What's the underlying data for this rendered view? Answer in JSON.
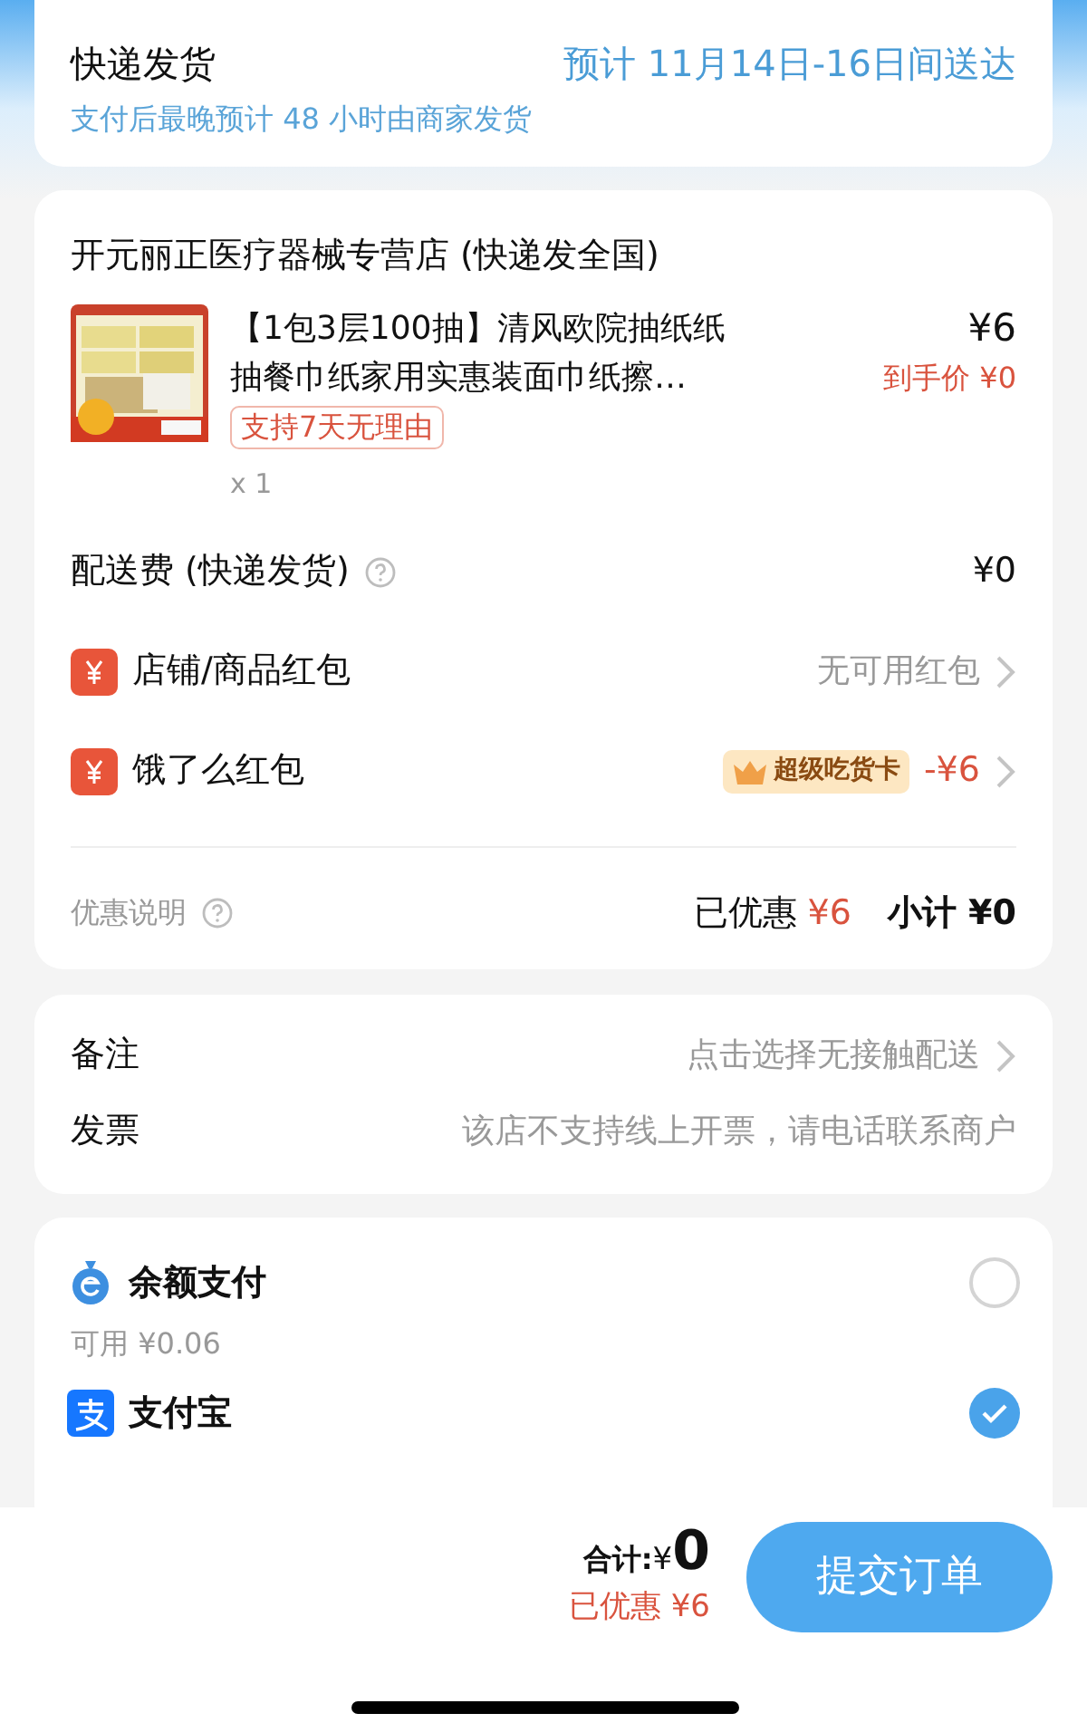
{
  "delivery": {
    "title": "快递发货",
    "eta": "预计 11月14日-16日间送达",
    "note": "支付后最晚预计 48 小时由商家发货"
  },
  "store": {
    "name": "开元丽正医疗器械专营店 (快递发全国)",
    "product": {
      "title": "【1包3层100抽】清风欧院抽纸纸抽餐巾纸家用实惠装面巾纸擦…",
      "price": "¥6",
      "final_price": "到手价 ¥0",
      "tag": "支持7天无理由",
      "quantity": "x 1"
    },
    "fee_rows": [
      {
        "kind": "fee",
        "label": "配送费 (快递发货)",
        "value": "¥0",
        "chevron": false
      },
      {
        "kind": "coupon",
        "label": "店铺/商品红包",
        "value": "无可用红包",
        "chevron": true
      },
      {
        "kind": "coupon",
        "label": "饿了么红包",
        "badge": "超级吃货卡",
        "value": "-¥6",
        "highlight": true,
        "chevron": true
      }
    ],
    "summary": {
      "label": "优惠说明",
      "saved_label": "已优惠",
      "saved": "¥6",
      "subtotal_label": "小计",
      "subtotal": "¥0"
    }
  },
  "extras": [
    {
      "label": "备注",
      "value": "点击选择无接触配送",
      "chevron": true
    },
    {
      "label": "发票",
      "value": "该店不支持线上开票，请电话联系商户",
      "chevron": false
    }
  ],
  "payments": [
    {
      "kind": "balance",
      "name": "余额支付",
      "detail": "可用 ¥0.06",
      "selected": false
    },
    {
      "kind": "alipay",
      "name": "支付宝",
      "selected": true
    }
  ],
  "footer": {
    "total_label": "合计:",
    "currency": "¥",
    "total": "0",
    "saved": "已优惠 ¥6",
    "submit": "提交订单"
  }
}
